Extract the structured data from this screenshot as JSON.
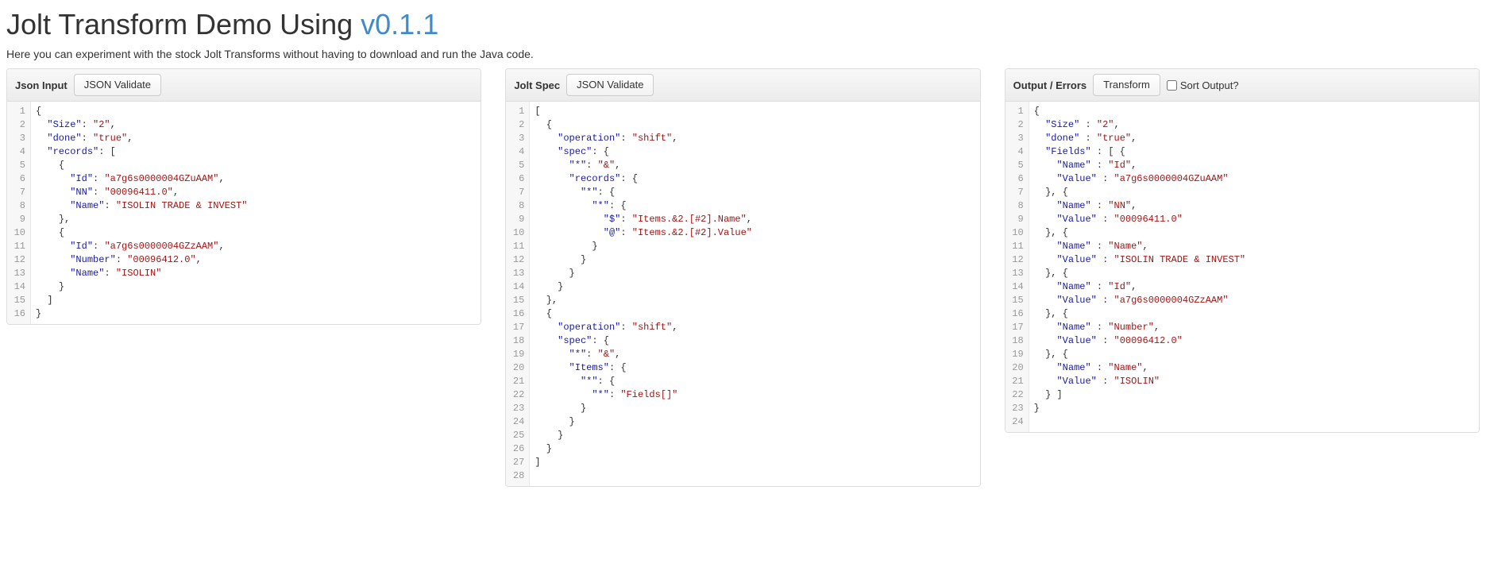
{
  "header": {
    "title_prefix": "Jolt Transform Demo Using ",
    "version": "v0.1.1",
    "subtitle": "Here you can experiment with the stock Jolt Transforms without having to download and run the Java code."
  },
  "panels": {
    "input": {
      "title": "Json Input",
      "validate_btn": "JSON Validate",
      "lines": [
        [
          [
            "punc",
            "{"
          ]
        ],
        [
          [
            "indent",
            "  "
          ],
          [
            "key",
            "\"Size\""
          ],
          [
            "punc",
            ": "
          ],
          [
            "str",
            "\"2\""
          ],
          [
            "punc",
            ","
          ]
        ],
        [
          [
            "indent",
            "  "
          ],
          [
            "key",
            "\"done\""
          ],
          [
            "punc",
            ": "
          ],
          [
            "str",
            "\"true\""
          ],
          [
            "punc",
            ","
          ]
        ],
        [
          [
            "indent",
            "  "
          ],
          [
            "key",
            "\"records\""
          ],
          [
            "punc",
            ": ["
          ]
        ],
        [
          [
            "indent",
            "    "
          ],
          [
            "punc",
            "{"
          ]
        ],
        [
          [
            "indent",
            "      "
          ],
          [
            "key",
            "\"Id\""
          ],
          [
            "punc",
            ": "
          ],
          [
            "str",
            "\"a7g6s0000004GZuAAM\""
          ],
          [
            "punc",
            ","
          ]
        ],
        [
          [
            "indent",
            "      "
          ],
          [
            "key",
            "\"NN\""
          ],
          [
            "punc",
            ": "
          ],
          [
            "str",
            "\"00096411.0\""
          ],
          [
            "punc",
            ","
          ]
        ],
        [
          [
            "indent",
            "      "
          ],
          [
            "key",
            "\"Name\""
          ],
          [
            "punc",
            ": "
          ],
          [
            "str",
            "\"ISOLIN TRADE & INVEST\""
          ]
        ],
        [
          [
            "indent",
            "    "
          ],
          [
            "punc",
            "},"
          ]
        ],
        [
          [
            "indent",
            "    "
          ],
          [
            "punc",
            "{"
          ]
        ],
        [
          [
            "indent",
            "      "
          ],
          [
            "key",
            "\"Id\""
          ],
          [
            "punc",
            ": "
          ],
          [
            "str",
            "\"a7g6s0000004GZzAAM\""
          ],
          [
            "punc",
            ","
          ]
        ],
        [
          [
            "indent",
            "      "
          ],
          [
            "key",
            "\"Number\""
          ],
          [
            "punc",
            ": "
          ],
          [
            "str",
            "\"00096412.0\""
          ],
          [
            "punc",
            ","
          ]
        ],
        [
          [
            "indent",
            "      "
          ],
          [
            "key",
            "\"Name\""
          ],
          [
            "punc",
            ": "
          ],
          [
            "str",
            "\"ISOLIN\""
          ]
        ],
        [
          [
            "indent",
            "    "
          ],
          [
            "punc",
            "}"
          ]
        ],
        [
          [
            "indent",
            "  "
          ],
          [
            "punc",
            "]"
          ]
        ],
        [
          [
            "punc",
            "}"
          ]
        ]
      ]
    },
    "spec": {
      "title": "Jolt Spec",
      "validate_btn": "JSON Validate",
      "lines": [
        [
          [
            "punc",
            "["
          ]
        ],
        [
          [
            "indent",
            "  "
          ],
          [
            "punc",
            "{"
          ]
        ],
        [
          [
            "indent",
            "    "
          ],
          [
            "key",
            "\"operation\""
          ],
          [
            "punc",
            ": "
          ],
          [
            "str",
            "\"shift\""
          ],
          [
            "punc",
            ","
          ]
        ],
        [
          [
            "indent",
            "    "
          ],
          [
            "key",
            "\"spec\""
          ],
          [
            "punc",
            ": {"
          ]
        ],
        [
          [
            "indent",
            "      "
          ],
          [
            "key",
            "\"*\""
          ],
          [
            "punc",
            ": "
          ],
          [
            "str",
            "\"&\""
          ],
          [
            "punc",
            ","
          ]
        ],
        [
          [
            "indent",
            "      "
          ],
          [
            "key",
            "\"records\""
          ],
          [
            "punc",
            ": {"
          ]
        ],
        [
          [
            "indent",
            "        "
          ],
          [
            "key",
            "\"*\""
          ],
          [
            "punc",
            ": {"
          ]
        ],
        [
          [
            "indent",
            "          "
          ],
          [
            "key",
            "\"*\""
          ],
          [
            "punc",
            ": {"
          ]
        ],
        [
          [
            "indent",
            "            "
          ],
          [
            "key",
            "\"$\""
          ],
          [
            "punc",
            ": "
          ],
          [
            "str",
            "\"Items.&2.[#2].Name\""
          ],
          [
            "punc",
            ","
          ]
        ],
        [
          [
            "indent",
            "            "
          ],
          [
            "key",
            "\"@\""
          ],
          [
            "punc",
            ": "
          ],
          [
            "str",
            "\"Items.&2.[#2].Value\""
          ]
        ],
        [
          [
            "indent",
            "          "
          ],
          [
            "punc",
            "}"
          ]
        ],
        [
          [
            "indent",
            "        "
          ],
          [
            "punc",
            "}"
          ]
        ],
        [
          [
            "indent",
            "      "
          ],
          [
            "punc",
            "}"
          ]
        ],
        [
          [
            "indent",
            "    "
          ],
          [
            "punc",
            "}"
          ]
        ],
        [
          [
            "indent",
            "  "
          ],
          [
            "punc",
            "},"
          ]
        ],
        [
          [
            "indent",
            "  "
          ],
          [
            "punc",
            "{"
          ]
        ],
        [
          [
            "indent",
            "    "
          ],
          [
            "key",
            "\"operation\""
          ],
          [
            "punc",
            ": "
          ],
          [
            "str",
            "\"shift\""
          ],
          [
            "punc",
            ","
          ]
        ],
        [
          [
            "indent",
            "    "
          ],
          [
            "key",
            "\"spec\""
          ],
          [
            "punc",
            ": {"
          ]
        ],
        [
          [
            "indent",
            "      "
          ],
          [
            "key",
            "\"*\""
          ],
          [
            "punc",
            ": "
          ],
          [
            "str",
            "\"&\""
          ],
          [
            "punc",
            ","
          ]
        ],
        [
          [
            "indent",
            "      "
          ],
          [
            "key",
            "\"Items\""
          ],
          [
            "punc",
            ": {"
          ]
        ],
        [
          [
            "indent",
            "        "
          ],
          [
            "key",
            "\"*\""
          ],
          [
            "punc",
            ": {"
          ]
        ],
        [
          [
            "indent",
            "          "
          ],
          [
            "key",
            "\"*\""
          ],
          [
            "punc",
            ": "
          ],
          [
            "str",
            "\"Fields[]\""
          ]
        ],
        [
          [
            "indent",
            "        "
          ],
          [
            "punc",
            "}"
          ]
        ],
        [
          [
            "indent",
            "      "
          ],
          [
            "punc",
            "}"
          ]
        ],
        [
          [
            "indent",
            "    "
          ],
          [
            "punc",
            "}"
          ]
        ],
        [
          [
            "indent",
            "  "
          ],
          [
            "punc",
            "}"
          ]
        ],
        [
          [
            "punc",
            "]"
          ]
        ],
        []
      ]
    },
    "output": {
      "title": "Output / Errors",
      "transform_btn": "Transform",
      "sort_label": "Sort Output?",
      "lines": [
        [
          [
            "punc",
            "{"
          ]
        ],
        [
          [
            "indent",
            "  "
          ],
          [
            "key",
            "\"Size\""
          ],
          [
            "punc",
            " : "
          ],
          [
            "str",
            "\"2\""
          ],
          [
            "punc",
            ","
          ]
        ],
        [
          [
            "indent",
            "  "
          ],
          [
            "key",
            "\"done\""
          ],
          [
            "punc",
            " : "
          ],
          [
            "str",
            "\"true\""
          ],
          [
            "punc",
            ","
          ]
        ],
        [
          [
            "indent",
            "  "
          ],
          [
            "key",
            "\"Fields\""
          ],
          [
            "punc",
            " : [ {"
          ]
        ],
        [
          [
            "indent",
            "    "
          ],
          [
            "key",
            "\"Name\""
          ],
          [
            "punc",
            " : "
          ],
          [
            "str",
            "\"Id\""
          ],
          [
            "punc",
            ","
          ]
        ],
        [
          [
            "indent",
            "    "
          ],
          [
            "key",
            "\"Value\""
          ],
          [
            "punc",
            " : "
          ],
          [
            "str",
            "\"a7g6s0000004GZuAAM\""
          ]
        ],
        [
          [
            "indent",
            "  "
          ],
          [
            "punc",
            "}, {"
          ]
        ],
        [
          [
            "indent",
            "    "
          ],
          [
            "key",
            "\"Name\""
          ],
          [
            "punc",
            " : "
          ],
          [
            "str",
            "\"NN\""
          ],
          [
            "punc",
            ","
          ]
        ],
        [
          [
            "indent",
            "    "
          ],
          [
            "key",
            "\"Value\""
          ],
          [
            "punc",
            " : "
          ],
          [
            "str",
            "\"00096411.0\""
          ]
        ],
        [
          [
            "indent",
            "  "
          ],
          [
            "punc",
            "}, {"
          ]
        ],
        [
          [
            "indent",
            "    "
          ],
          [
            "key",
            "\"Name\""
          ],
          [
            "punc",
            " : "
          ],
          [
            "str",
            "\"Name\""
          ],
          [
            "punc",
            ","
          ]
        ],
        [
          [
            "indent",
            "    "
          ],
          [
            "key",
            "\"Value\""
          ],
          [
            "punc",
            " : "
          ],
          [
            "str",
            "\"ISOLIN TRADE & INVEST\""
          ]
        ],
        [
          [
            "indent",
            "  "
          ],
          [
            "punc",
            "}, {"
          ]
        ],
        [
          [
            "indent",
            "    "
          ],
          [
            "key",
            "\"Name\""
          ],
          [
            "punc",
            " : "
          ],
          [
            "str",
            "\"Id\""
          ],
          [
            "punc",
            ","
          ]
        ],
        [
          [
            "indent",
            "    "
          ],
          [
            "key",
            "\"Value\""
          ],
          [
            "punc",
            " : "
          ],
          [
            "str",
            "\"a7g6s0000004GZzAAM\""
          ]
        ],
        [
          [
            "indent",
            "  "
          ],
          [
            "punc",
            "}, {"
          ]
        ],
        [
          [
            "indent",
            "    "
          ],
          [
            "key",
            "\"Name\""
          ],
          [
            "punc",
            " : "
          ],
          [
            "str",
            "\"Number\""
          ],
          [
            "punc",
            ","
          ]
        ],
        [
          [
            "indent",
            "    "
          ],
          [
            "key",
            "\"Value\""
          ],
          [
            "punc",
            " : "
          ],
          [
            "str",
            "\"00096412.0\""
          ]
        ],
        [
          [
            "indent",
            "  "
          ],
          [
            "punc",
            "}, {"
          ]
        ],
        [
          [
            "indent",
            "    "
          ],
          [
            "key",
            "\"Name\""
          ],
          [
            "punc",
            " : "
          ],
          [
            "str",
            "\"Name\""
          ],
          [
            "punc",
            ","
          ]
        ],
        [
          [
            "indent",
            "    "
          ],
          [
            "key",
            "\"Value\""
          ],
          [
            "punc",
            " : "
          ],
          [
            "str",
            "\"ISOLIN\""
          ]
        ],
        [
          [
            "indent",
            "  "
          ],
          [
            "punc",
            "} ]"
          ]
        ],
        [
          [
            "punc",
            "}"
          ]
        ],
        []
      ]
    }
  }
}
